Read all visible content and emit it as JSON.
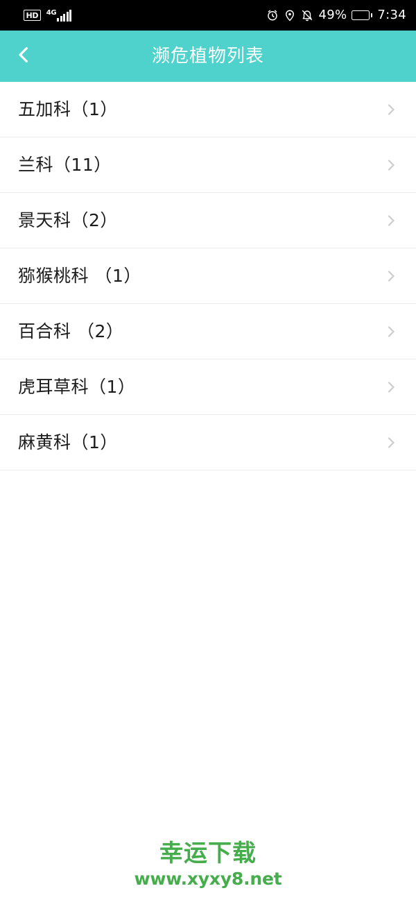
{
  "status_bar": {
    "hd_label": "HD",
    "network_label": "4G",
    "signal_icon": "signal-bars-icon",
    "alarm_icon": "alarm-clock-icon",
    "location_icon": "location-pin-icon",
    "mute_icon": "bell-muted-icon",
    "battery_percent": "49%",
    "battery_level": 49,
    "battery_icon": "battery-icon",
    "time": "7:34",
    "background_color": "#000000",
    "foreground_color": "#ffffff"
  },
  "header": {
    "title": "濒危植物列表",
    "back_icon": "chevron-left-icon",
    "background_color": "#4fd2cc",
    "text_color": "#ffffff"
  },
  "list": {
    "chevron_icon": "chevron-right-icon",
    "chevron_color": "#cccccc",
    "divider_color": "#ededed",
    "items": [
      {
        "label": "五加科（1）",
        "family": "五加科",
        "count": 1
      },
      {
        "label": "兰科（11）",
        "family": "兰科",
        "count": 11
      },
      {
        "label": "景天科（2）",
        "family": "景天科",
        "count": 2
      },
      {
        "label": "猕猴桃科 （1）",
        "family": "猕猴桃科",
        "count": 1
      },
      {
        "label": "百合科 （2）",
        "family": "百合科",
        "count": 2
      },
      {
        "label": "虎耳草科（1）",
        "family": "虎耳草科",
        "count": 1
      },
      {
        "label": "麻黄科（1）",
        "family": "麻黄科",
        "count": 1
      }
    ]
  },
  "watermark": {
    "title": "幸运下载",
    "url": "www.xyxy8.net",
    "color": "#45ad4b"
  }
}
